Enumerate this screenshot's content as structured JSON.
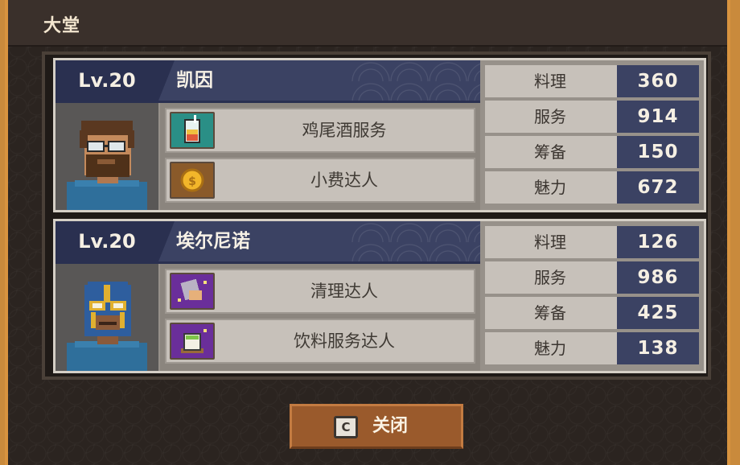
{
  "window": {
    "title": "大堂"
  },
  "staff": [
    {
      "level": "Lv.20",
      "name": "凯因",
      "portrait_icon": "bearded-man-with-glasses-portrait",
      "skills": [
        {
          "label": "鸡尾酒服务",
          "icon": "cocktail-icon",
          "icon_color": "#2a8f86"
        },
        {
          "label": "小费达人",
          "icon": "coin-icon",
          "icon_color": "#8a5a2a"
        }
      ],
      "stats": [
        {
          "label": "料理",
          "value": "360"
        },
        {
          "label": "服务",
          "value": "914"
        },
        {
          "label": "筹备",
          "value": "150"
        },
        {
          "label": "魅力",
          "value": "672"
        }
      ]
    },
    {
      "level": "Lv.20",
      "name": "埃尔尼诺",
      "portrait_icon": "masked-wrestler-portrait",
      "skills": [
        {
          "label": "清理达人",
          "icon": "cleaning-cloth-icon",
          "icon_color": "#6a2e9a"
        },
        {
          "label": "饮料服务达人",
          "icon": "drink-cup-icon",
          "icon_color": "#6a2e9a"
        }
      ],
      "stats": [
        {
          "label": "料理",
          "value": "126"
        },
        {
          "label": "服务",
          "value": "986"
        },
        {
          "label": "筹备",
          "value": "425"
        },
        {
          "label": "魅力",
          "value": "138"
        }
      ]
    }
  ],
  "close_button": {
    "key": "C",
    "label": "关闭"
  }
}
